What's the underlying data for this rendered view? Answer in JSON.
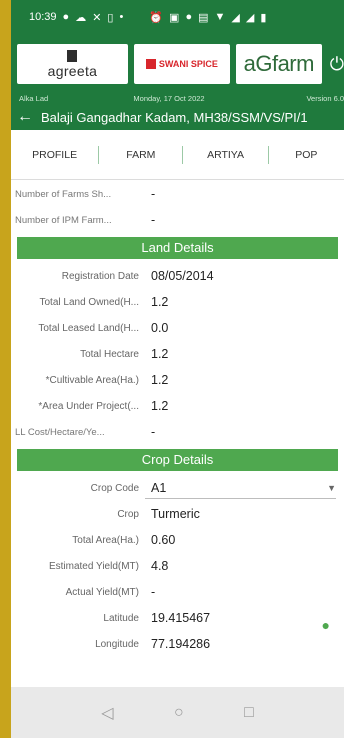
{
  "status_bar": {
    "time": "10:39",
    "icons": [
      "location-icon",
      "cloud-icon",
      "missed-call-icon",
      "sd-icon",
      "dot-icon",
      "alarm-icon",
      "nfc-icon",
      "location-icon",
      "data-icon",
      "wifi-icon",
      "signal-icon",
      "signal-icon",
      "battery-icon"
    ]
  },
  "header": {
    "logo1": {
      "name": "agreeta"
    },
    "logo2": {
      "name": "SWANI SPICE"
    },
    "logo3": {
      "name": "aGfarm"
    },
    "user": "Alka Lad",
    "date": "Monday, 17 Oct 2022",
    "version": "Version 6.0",
    "farmer_title": "Balaji Gangadhar Kadam, MH38/SSM/VS/PI/1"
  },
  "tabs": [
    "PROFILE",
    "FARM",
    "ARTIYA",
    "POP"
  ],
  "summary": [
    {
      "label": "Number of Farms Sh...",
      "value": "-"
    },
    {
      "label": "Number of IPM Farm...",
      "value": "-"
    }
  ],
  "land_details": {
    "title": "Land Details",
    "fields": [
      {
        "label": "Registration Date",
        "value": "08/05/2014"
      },
      {
        "label": "Total Land Owned(H...",
        "value": "1.2"
      },
      {
        "label": "Total Leased Land(H...",
        "value": "0.0"
      },
      {
        "label": "Total Hectare",
        "value": "1.2"
      },
      {
        "label": "*Cultivable Area(Ha.)",
        "value": "1.2"
      },
      {
        "label": "*Area Under Project(...",
        "value": "1.2"
      },
      {
        "label": "LL Cost/Hectare/Ye...",
        "value": "-"
      }
    ]
  },
  "crop_details": {
    "title": "Crop Details",
    "crop_code": {
      "label": "Crop Code",
      "value": "A1"
    },
    "fields": [
      {
        "label": "Crop",
        "value": "Turmeric"
      },
      {
        "label": "Total Area(Ha.)",
        "value": "0.60"
      },
      {
        "label": "Estimated Yield(MT)",
        "value": "4.8"
      },
      {
        "label": "Actual Yield(MT)",
        "value": "-"
      },
      {
        "label": "Latitude",
        "value": "19.415467"
      },
      {
        "label": "Longitude",
        "value": "77.194286"
      }
    ]
  },
  "colors": {
    "header_green": "#1f7a3d",
    "section_green": "#4fa84f",
    "outer_frame": "#c8a41c"
  }
}
